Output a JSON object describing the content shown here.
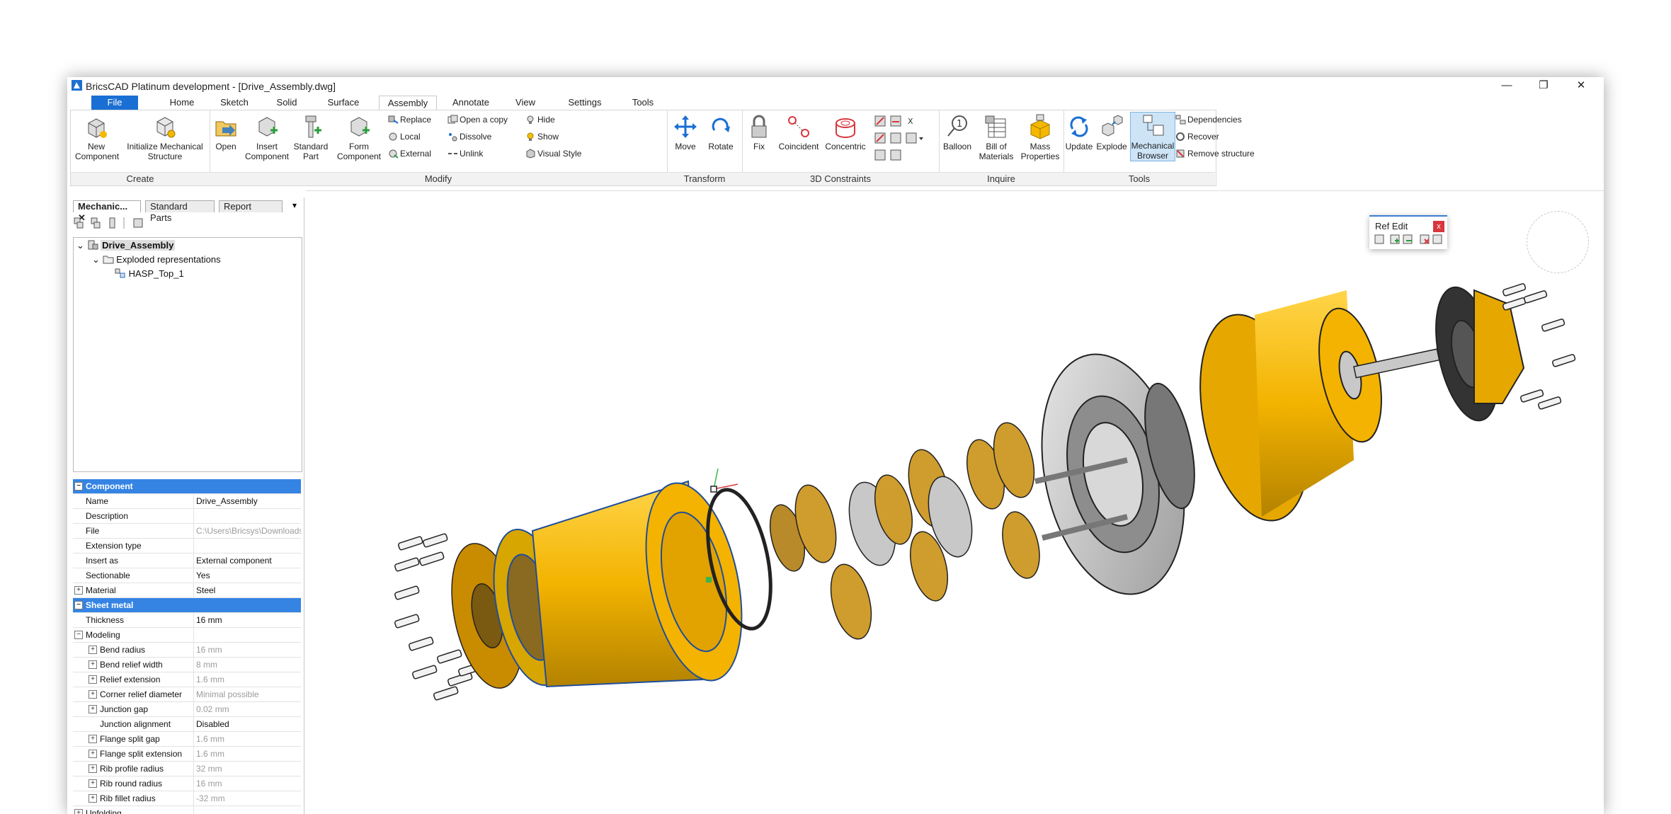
{
  "window": {
    "title": "BricsCAD Platinum development - [Drive_Assembly.dwg]",
    "controls": {
      "minimize": "—",
      "restore": "❐",
      "close": "✕"
    }
  },
  "ribbon_tabs": [
    "File",
    "Home",
    "Sketch",
    "Solid",
    "Surface",
    "Assembly",
    "Annotate",
    "View",
    "Settings",
    "Tools"
  ],
  "active_tab": "Assembly",
  "panels": {
    "create": {
      "title": "Create",
      "new_component": "New Component",
      "init_structure": "Initialize Mechanical Structure"
    },
    "modify": {
      "title": "Modify",
      "open": "Open",
      "insert_component": "Insert Component",
      "standard_part": "Standard Part",
      "form_component": "Form Component",
      "replace": "Replace",
      "local": "Local",
      "external": "External",
      "open_copy": "Open a copy",
      "dissolve": "Dissolve",
      "unlink": "Unlink",
      "hide": "Hide",
      "show": "Show",
      "visual_style": "Visual Style"
    },
    "transform": {
      "title": "Transform",
      "move": "Move",
      "rotate": "Rotate"
    },
    "constraints": {
      "title": "3D Constraints",
      "fix": "Fix",
      "coincident": "Coincident",
      "concentric": "Concentric"
    },
    "inquire": {
      "title": "Inquire",
      "balloon": "Balloon",
      "bom": "Bill of Materials",
      "mass": "Mass Properties"
    },
    "tools": {
      "title": "Tools",
      "update": "Update",
      "explode": "Explode",
      "mech_browser": "Mechanical Browser",
      "dependencies": "Dependencies",
      "recover": "Recover",
      "remove_structure": "Remove structure"
    }
  },
  "left_panel": {
    "tabs": [
      "Mechanic...",
      "Standard Parts",
      "Report"
    ],
    "tree": {
      "root": "Drive_Assembly",
      "child": "Exploded representations",
      "grandchild": "HASP_Top_1"
    }
  },
  "properties": [
    {
      "type": "header",
      "label": "Component"
    },
    {
      "label": "Name",
      "value": "Drive_Assembly"
    },
    {
      "label": "Description",
      "value": ""
    },
    {
      "label": "File",
      "value": "C:\\Users\\Bricsys\\Downloads",
      "grey": true
    },
    {
      "label": "Extension type",
      "value": ""
    },
    {
      "label": "Insert as",
      "value": "External component"
    },
    {
      "label": "Sectionable",
      "value": "Yes"
    },
    {
      "label": "Material",
      "value": "Steel",
      "expand": true
    },
    {
      "type": "header",
      "label": "Sheet metal"
    },
    {
      "label": "Thickness",
      "value": "16 mm"
    },
    {
      "label": "Modeling",
      "value": "",
      "expand": true,
      "group": true
    },
    {
      "label": "Bend radius",
      "value": "16 mm",
      "grey": true,
      "expand": true,
      "indent": true
    },
    {
      "label": "Bend relief width",
      "value": "8 mm",
      "grey": true,
      "expand": true,
      "indent": true
    },
    {
      "label": "Relief extension",
      "value": "1.6 mm",
      "grey": true,
      "expand": true,
      "indent": true
    },
    {
      "label": "Corner relief diameter",
      "value": "Minimal possible",
      "grey": true,
      "expand": true,
      "indent": true
    },
    {
      "label": "Junction gap",
      "value": "0.02 mm",
      "grey": true,
      "expand": true,
      "indent": true
    },
    {
      "label": "Junction alignment",
      "value": "Disabled",
      "indent": true
    },
    {
      "label": "Flange split gap",
      "value": "1.6 mm",
      "grey": true,
      "expand": true,
      "indent": true
    },
    {
      "label": "Flange split extension",
      "value": "1.6 mm",
      "grey": true,
      "expand": true,
      "indent": true
    },
    {
      "label": "Rib profile radius",
      "value": "32 mm",
      "grey": true,
      "expand": true,
      "indent": true
    },
    {
      "label": "Rib round radius",
      "value": "16 mm",
      "grey": true,
      "expand": true,
      "indent": true
    },
    {
      "label": "Rib fillet radius",
      "value": "-32 mm",
      "grey": true,
      "expand": true,
      "indent": true
    },
    {
      "label": "Unfolding",
      "value": "",
      "expand": true,
      "group": true
    }
  ],
  "ref_edit": {
    "title": "Ref Edit",
    "close": "x"
  },
  "colors": {
    "accent": "#1a6fd4",
    "gold": "#f5b800",
    "header": "#3584e4",
    "gear": "#c9c9c9"
  }
}
